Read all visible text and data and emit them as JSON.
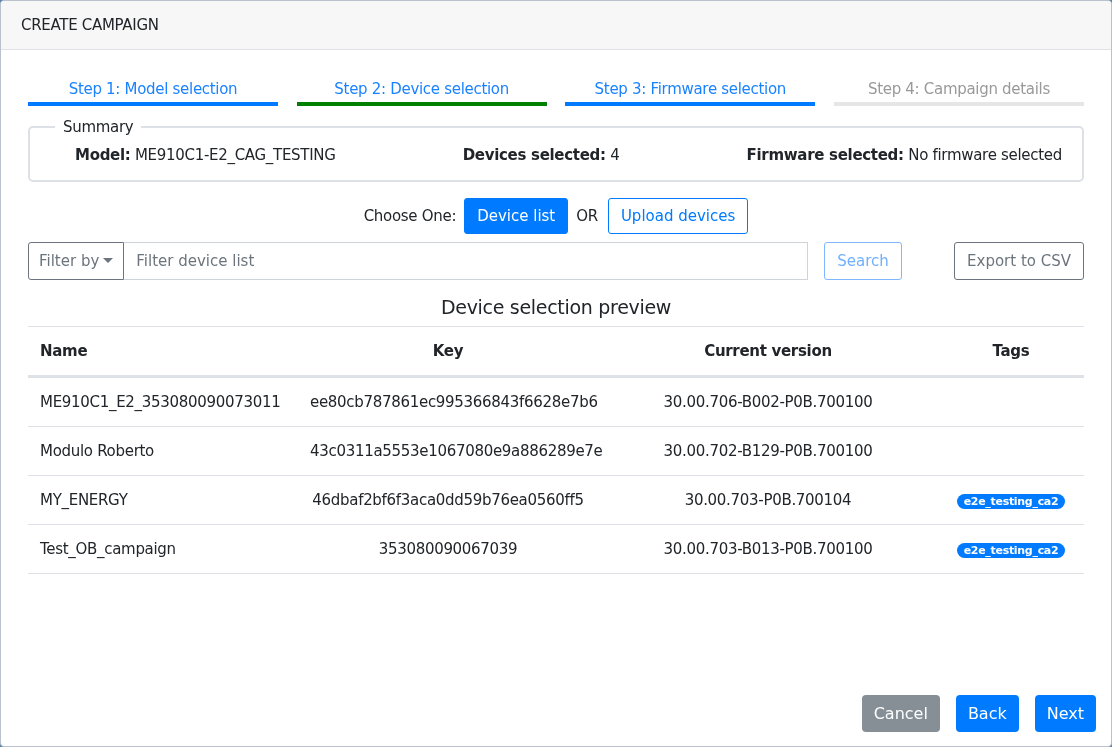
{
  "window": {
    "title": "CREATE CAMPAIGN"
  },
  "steps": [
    {
      "label": "Step 1: Model selection",
      "kind": "done"
    },
    {
      "label": "Step 2: Device selection",
      "kind": "current"
    },
    {
      "label": "Step 3: Firmware selection",
      "kind": "done"
    },
    {
      "label": "Step 4: Campaign details",
      "kind": "pending"
    }
  ],
  "summary": {
    "legend": "Summary",
    "items": [
      {
        "label": "Model:",
        "value": "ME910C1-E2_CAG_TESTING"
      },
      {
        "label": "Devices selected:",
        "value": "4"
      },
      {
        "label": "Firmware selected:",
        "value": "No firmware selected"
      }
    ]
  },
  "source": {
    "label": "Choose One:",
    "separator": "OR",
    "options": [
      {
        "label": "Device list",
        "selected": true
      },
      {
        "label": "Upload devices",
        "selected": false
      }
    ]
  },
  "filter": {
    "dropdown": "Filter by",
    "placeholder": "Filter device list",
    "search": "Search",
    "export": "Export to CSV"
  },
  "table": {
    "title": "Device selection preview",
    "columns": [
      "Name",
      "Key",
      "Current version",
      "Tags"
    ],
    "rows": [
      {
        "name": "ME910C1_E2_353080090073011",
        "key": "ee80cb787861ec995366843f6628e7b6",
        "version": "30.00.706-B002-P0B.700100",
        "tags": []
      },
      {
        "name": "Modulo Roberto",
        "key": "43c0311a5553e1067080e9a886289e7e",
        "version": "30.00.702-B129-P0B.700100",
        "tags": []
      },
      {
        "name": "MY_ENERGY",
        "key": "46dbaf2bf6f3aca0dd59b76ea0560ff5",
        "version": "30.00.703-P0B.700104",
        "tags": [
          "e2e_testing_ca2"
        ]
      },
      {
        "name": "Test_OB_campaign",
        "key": "353080090067039",
        "version": "30.00.703-B013-P0B.700100",
        "tags": [
          "e2e_testing_ca2"
        ]
      }
    ]
  },
  "buttons": [
    {
      "label": "Cancel",
      "kind": "secondary"
    },
    {
      "label": "Back",
      "kind": "primary"
    },
    {
      "label": "Next",
      "kind": "primary"
    }
  ]
}
